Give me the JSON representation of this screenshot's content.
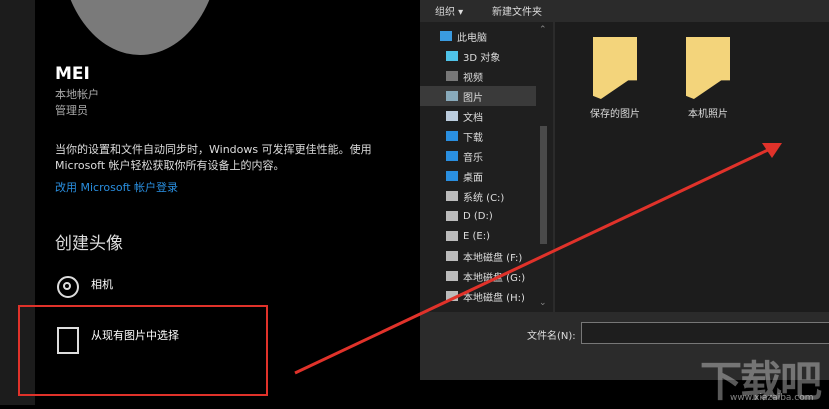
{
  "account": {
    "name": "MEI",
    "type": "本地帐户",
    "role": "管理员",
    "description": "当你的设置和文件自动同步时，Windows 可发挥更佳性能。使用 Microsoft 帐户轻松获取你所有设备上的内容。",
    "signin_link": "改用 Microsoft 帐户登录"
  },
  "create_avatar": {
    "heading": "创建头像",
    "camera": "相机",
    "browse": "从现有图片中选择"
  },
  "dialog": {
    "toolbar": {
      "organize": "组织 ▾",
      "new_folder": "新建文件夹"
    },
    "nav": [
      {
        "label": "此电脑",
        "icon": "computer-icon"
      },
      {
        "label": "3D 对象",
        "icon": "cube-icon"
      },
      {
        "label": "视频",
        "icon": "video-icon"
      },
      {
        "label": "图片",
        "icon": "pictures-icon",
        "selected": true
      },
      {
        "label": "文档",
        "icon": "document-icon"
      },
      {
        "label": "下载",
        "icon": "download-icon"
      },
      {
        "label": "音乐",
        "icon": "music-icon"
      },
      {
        "label": "桌面",
        "icon": "desktop-icon"
      },
      {
        "label": "系统 (C:)",
        "icon": "drive-icon"
      },
      {
        "label": "D (D:)",
        "icon": "drive-icon"
      },
      {
        "label": "E (E:)",
        "icon": "drive-icon"
      },
      {
        "label": "本地磁盘 (F:)",
        "icon": "drive-icon"
      },
      {
        "label": "本地磁盘 (G:)",
        "icon": "drive-icon"
      },
      {
        "label": "本地磁盘 (H:)",
        "icon": "drive-icon"
      }
    ],
    "folders": [
      "保存的图片",
      "本机照片"
    ],
    "filename_label": "文件名(N):",
    "filename_value": ""
  },
  "watermark": {
    "text": "下载吧",
    "url": "www.xiazaiba.com"
  },
  "colors": {
    "accent": "#2a8fe0",
    "annotation": "#e0322a",
    "folder": "#f3d47b"
  }
}
